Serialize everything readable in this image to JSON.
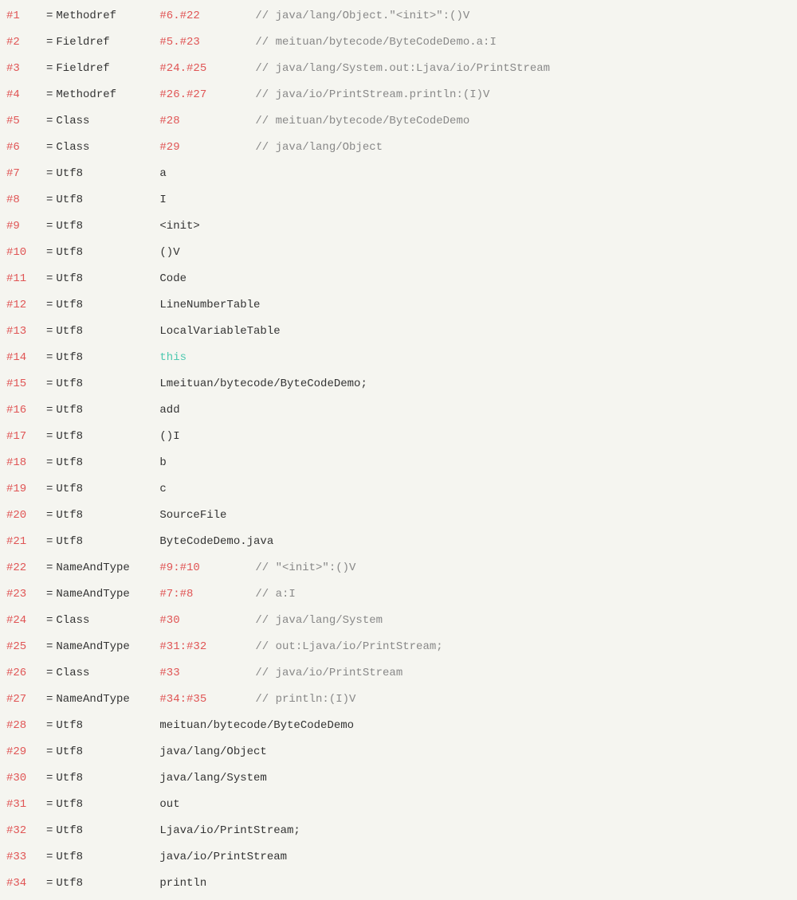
{
  "rows": [
    {
      "index": "#1",
      "type": "Methodref",
      "ref": "#6.#22",
      "refType": "link",
      "comment": "// java/lang/Object.\"<init>\":()V"
    },
    {
      "index": "#2",
      "type": "Fieldref",
      "ref": "#5.#23",
      "refType": "link",
      "comment": "// meituan/bytecode/ByteCodeDemo.a:I"
    },
    {
      "index": "#3",
      "type": "Fieldref",
      "ref": "#24.#25",
      "refType": "link",
      "comment": "// java/lang/System.out:Ljava/io/PrintStream"
    },
    {
      "index": "#4",
      "type": "Methodref",
      "ref": "#26.#27",
      "refType": "link",
      "comment": "// java/io/PrintStream.println:(I)V"
    },
    {
      "index": "#5",
      "type": "Class",
      "ref": "#28",
      "refType": "link",
      "comment": "// meituan/bytecode/ByteCodeDemo"
    },
    {
      "index": "#6",
      "type": "Class",
      "ref": "#29",
      "refType": "link",
      "comment": "// java/lang/Object"
    },
    {
      "index": "#7",
      "type": "Utf8",
      "ref": "a",
      "refType": "plain",
      "comment": ""
    },
    {
      "index": "#8",
      "type": "Utf8",
      "ref": "I",
      "refType": "plain",
      "comment": ""
    },
    {
      "index": "#9",
      "type": "Utf8",
      "ref": "<init>",
      "refType": "plain",
      "comment": ""
    },
    {
      "index": "#10",
      "type": "Utf8",
      "ref": "()V",
      "refType": "plain",
      "comment": ""
    },
    {
      "index": "#11",
      "type": "Utf8",
      "ref": "Code",
      "refType": "plain",
      "comment": ""
    },
    {
      "index": "#12",
      "type": "Utf8",
      "ref": "LineNumberTable",
      "refType": "plain",
      "comment": ""
    },
    {
      "index": "#13",
      "type": "Utf8",
      "ref": "LocalVariableTable",
      "refType": "plain",
      "comment": ""
    },
    {
      "index": "#14",
      "type": "Utf8",
      "ref": "this",
      "refType": "keyword",
      "comment": ""
    },
    {
      "index": "#15",
      "type": "Utf8",
      "ref": "Lmeituan/bytecode/ByteCodeDemo;",
      "refType": "plain",
      "comment": ""
    },
    {
      "index": "#16",
      "type": "Utf8",
      "ref": "add",
      "refType": "plain",
      "comment": ""
    },
    {
      "index": "#17",
      "type": "Utf8",
      "ref": "()I",
      "refType": "plain",
      "comment": ""
    },
    {
      "index": "#18",
      "type": "Utf8",
      "ref": "b",
      "refType": "plain",
      "comment": ""
    },
    {
      "index": "#19",
      "type": "Utf8",
      "ref": "c",
      "refType": "plain",
      "comment": ""
    },
    {
      "index": "#20",
      "type": "Utf8",
      "ref": "SourceFile",
      "refType": "plain",
      "comment": ""
    },
    {
      "index": "#21",
      "type": "Utf8",
      "ref": "ByteCodeDemo.java",
      "refType": "plain",
      "comment": ""
    },
    {
      "index": "#22",
      "type": "NameAndType",
      "ref": "#9:#10",
      "refType": "link",
      "comment": "// \"<init>\":()V"
    },
    {
      "index": "#23",
      "type": "NameAndType",
      "ref": "#7:#8",
      "refType": "link",
      "comment": "// a:I"
    },
    {
      "index": "#24",
      "type": "Class",
      "ref": "#30",
      "refType": "link",
      "comment": "// java/lang/System"
    },
    {
      "index": "#25",
      "type": "NameAndType",
      "ref": "#31:#32",
      "refType": "link",
      "comment": "// out:Ljava/io/PrintStream;"
    },
    {
      "index": "#26",
      "type": "Class",
      "ref": "#33",
      "refType": "link",
      "comment": "// java/io/PrintStream"
    },
    {
      "index": "#27",
      "type": "NameAndType",
      "ref": "#34:#35",
      "refType": "link",
      "comment": "// println:(I)V"
    },
    {
      "index": "#28",
      "type": "Utf8",
      "ref": "meituan/bytecode/ByteCodeDemo",
      "refType": "plain",
      "comment": ""
    },
    {
      "index": "#29",
      "type": "Utf8",
      "ref": "java/lang/Object",
      "refType": "plain",
      "comment": ""
    },
    {
      "index": "#30",
      "type": "Utf8",
      "ref": "java/lang/System",
      "refType": "plain",
      "comment": ""
    },
    {
      "index": "#31",
      "type": "Utf8",
      "ref": "out",
      "refType": "plain",
      "comment": ""
    },
    {
      "index": "#32",
      "type": "Utf8",
      "ref": "Ljava/io/PrintStream;",
      "refType": "plain",
      "comment": ""
    },
    {
      "index": "#33",
      "type": "Utf8",
      "ref": "java/io/PrintStream",
      "refType": "plain",
      "comment": ""
    },
    {
      "index": "#34",
      "type": "Utf8",
      "ref": "println",
      "refType": "plain",
      "comment": ""
    }
  ]
}
